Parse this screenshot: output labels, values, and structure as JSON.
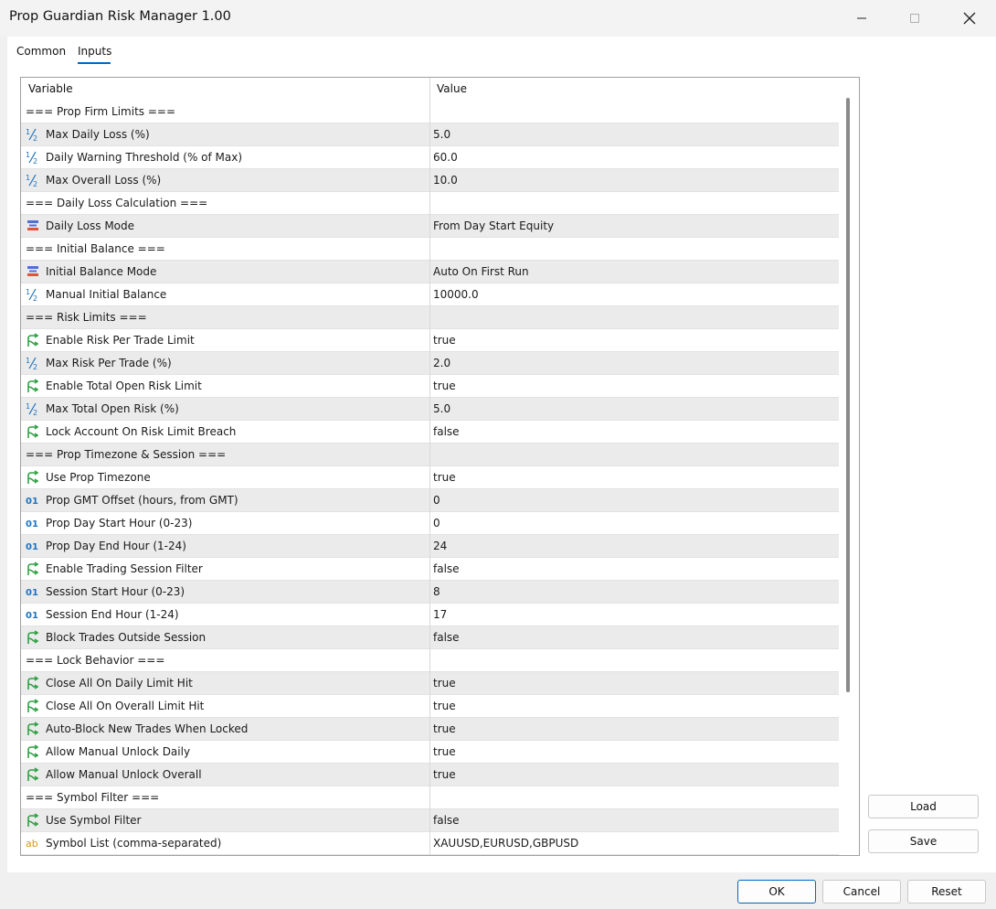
{
  "window": {
    "title": "Prop Guardian Risk Manager 1.00"
  },
  "tabs": [
    {
      "label": "Common",
      "active": false
    },
    {
      "label": "Inputs",
      "active": true
    }
  ],
  "grid": {
    "columns": [
      "Variable",
      "Value"
    ],
    "rows": [
      {
        "kind": "section",
        "label": "=== Prop Firm Limits ===",
        "value": ""
      },
      {
        "kind": "double",
        "icon": "fraction-icon",
        "label": "Max Daily Loss (%)",
        "value": "5.0"
      },
      {
        "kind": "double",
        "icon": "fraction-icon",
        "label": "Daily Warning Threshold (% of Max)",
        "value": "60.0"
      },
      {
        "kind": "double",
        "icon": "fraction-icon",
        "label": "Max Overall Loss (%)",
        "value": "10.0"
      },
      {
        "kind": "section",
        "label": "=== Daily Loss Calculation ===",
        "value": ""
      },
      {
        "kind": "enum",
        "icon": "enum-list-icon",
        "label": "Daily Loss Mode",
        "value": "From Day Start Equity"
      },
      {
        "kind": "section",
        "label": "=== Initial Balance ===",
        "value": ""
      },
      {
        "kind": "enum",
        "icon": "enum-list-icon",
        "label": "Initial Balance Mode",
        "value": "Auto On First Run"
      },
      {
        "kind": "double",
        "icon": "fraction-icon",
        "label": "Manual Initial Balance",
        "value": "10000.0"
      },
      {
        "kind": "section",
        "label": "=== Risk Limits ===",
        "value": ""
      },
      {
        "kind": "bool",
        "icon": "branch-arrow-icon",
        "label": "Enable Risk Per Trade Limit",
        "value": "true"
      },
      {
        "kind": "double",
        "icon": "fraction-icon",
        "label": "Max Risk Per Trade (%)",
        "value": "2.0"
      },
      {
        "kind": "bool",
        "icon": "branch-arrow-icon",
        "label": "Enable Total Open Risk Limit",
        "value": "true"
      },
      {
        "kind": "double",
        "icon": "fraction-icon",
        "label": "Max Total Open Risk (%)",
        "value": "5.0"
      },
      {
        "kind": "bool",
        "icon": "branch-arrow-icon",
        "label": "Lock Account On Risk Limit Breach",
        "value": "false"
      },
      {
        "kind": "section",
        "label": "=== Prop Timezone & Session ===",
        "value": ""
      },
      {
        "kind": "bool",
        "icon": "branch-arrow-icon",
        "label": "Use Prop Timezone",
        "value": "true"
      },
      {
        "kind": "int",
        "icon": "integer-icon",
        "label": "Prop GMT Offset (hours, from GMT)",
        "value": "0"
      },
      {
        "kind": "int",
        "icon": "integer-icon",
        "label": "Prop Day Start Hour (0-23)",
        "value": "0"
      },
      {
        "kind": "int",
        "icon": "integer-icon",
        "label": "Prop Day End Hour (1-24)",
        "value": "24"
      },
      {
        "kind": "bool",
        "icon": "branch-arrow-icon",
        "label": "Enable Trading Session Filter",
        "value": "false"
      },
      {
        "kind": "int",
        "icon": "integer-icon",
        "label": "Session Start Hour (0-23)",
        "value": "8"
      },
      {
        "kind": "int",
        "icon": "integer-icon",
        "label": "Session End Hour (1-24)",
        "value": "17"
      },
      {
        "kind": "bool",
        "icon": "branch-arrow-icon",
        "label": "Block Trades Outside Session",
        "value": "false"
      },
      {
        "kind": "section",
        "label": "=== Lock Behavior ===",
        "value": ""
      },
      {
        "kind": "bool",
        "icon": "branch-arrow-icon",
        "label": "Close All On Daily Limit Hit",
        "value": "true"
      },
      {
        "kind": "bool",
        "icon": "branch-arrow-icon",
        "label": "Close All On Overall Limit Hit",
        "value": "true"
      },
      {
        "kind": "bool",
        "icon": "branch-arrow-icon",
        "label": "Auto-Block New Trades When Locked",
        "value": "true"
      },
      {
        "kind": "bool",
        "icon": "branch-arrow-icon",
        "label": "Allow Manual Unlock Daily",
        "value": "true"
      },
      {
        "kind": "bool",
        "icon": "branch-arrow-icon",
        "label": "Allow Manual Unlock Overall",
        "value": "true"
      },
      {
        "kind": "section",
        "label": "=== Symbol Filter ===",
        "value": ""
      },
      {
        "kind": "bool",
        "icon": "branch-arrow-icon",
        "label": "Use Symbol Filter",
        "value": "false"
      },
      {
        "kind": "string",
        "icon": "string-ab-icon",
        "label": "Symbol List (comma-separated)",
        "value": "XAUUSD,EURUSD,GBPUSD"
      }
    ]
  },
  "side_buttons": {
    "load_label": "Load",
    "save_label": "Save"
  },
  "footer": {
    "ok_label": "OK",
    "cancel_label": "Cancel",
    "reset_label": "Reset"
  },
  "colors": {
    "accent": "#0067c0",
    "double_icon": "#1e73be",
    "int_icon": "#1e73be",
    "bool_icon": "#2ea043",
    "enum_icon_top": "#4f6fd8",
    "enum_icon_bottom": "#e0533a",
    "string_icon": "#d49a1a"
  }
}
